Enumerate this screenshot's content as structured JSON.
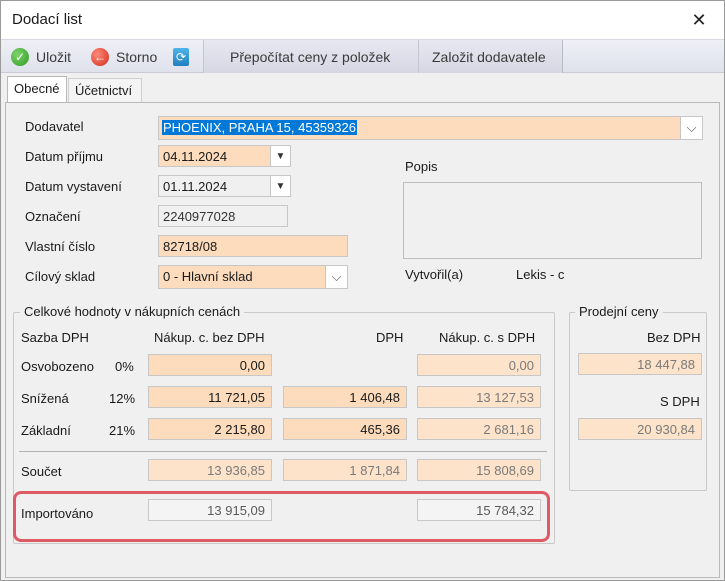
{
  "window": {
    "title": "Dodací list",
    "close_icon": "close-icon"
  },
  "toolbar": {
    "save_label": "Uložit",
    "cancel_label": "Storno",
    "refresh_icon": "refresh-icon",
    "recalc_label": "Přepočítat ceny z položek",
    "create_supplier_label": "Založit dodavatele"
  },
  "tabs": {
    "general": "Obecné",
    "accounting": "Účetnictví"
  },
  "form": {
    "supplier_label": "Dodavatel",
    "supplier_value": "PHOENIX, PRAHA 15, 45359326",
    "received_label": "Datum příjmu",
    "received_value": "04.11.2024",
    "issued_label": "Datum vystavení",
    "issued_value": "01.11.2024",
    "designation_label": "Označení",
    "designation_value": "2240977028",
    "own_number_label": "Vlastní číslo",
    "own_number_value": "82718/08",
    "target_store_label": "Cílový sklad",
    "target_store_value": "0 - Hlavní sklad",
    "description_label": "Popis",
    "created_by_label": "Vytvořil(a)",
    "created_by_value": "Lekis - c"
  },
  "totals": {
    "group_title": "Celkové hodnoty v nákupních cenách",
    "col_rate": "Sazba DPH",
    "col_net": "Nákup. c. bez DPH",
    "col_vat": "DPH",
    "col_gross": "Nákup. c. s DPH",
    "rows": [
      {
        "name": "Osvobozeno",
        "rate": "0%",
        "net": "0,00",
        "vat": "",
        "gross": "0,00"
      },
      {
        "name": "Snížená",
        "rate": "12%",
        "net": "11 721,05",
        "vat": "1 406,48",
        "gross": "13 127,53"
      },
      {
        "name": "Základní",
        "rate": "21%",
        "net": "2 215,80",
        "vat": "465,36",
        "gross": "2 681,16"
      }
    ],
    "sum_label": "Součet",
    "sum_net": "13 936,85",
    "sum_vat": "1 871,84",
    "sum_gross": "15 808,69",
    "imported_label": "Importováno",
    "imported_net": "13 915,09",
    "imported_gross": "15 784,32"
  },
  "sale_prices": {
    "group_title": "Prodejní ceny",
    "net_label": "Bez DPH",
    "net_value": "18 447,88",
    "gross_label": "S DPH",
    "gross_value": "20 930,84"
  },
  "colors": {
    "field_peach": "#fcdcbc",
    "highlight": "#e05a66",
    "selection": "#0078d7"
  }
}
